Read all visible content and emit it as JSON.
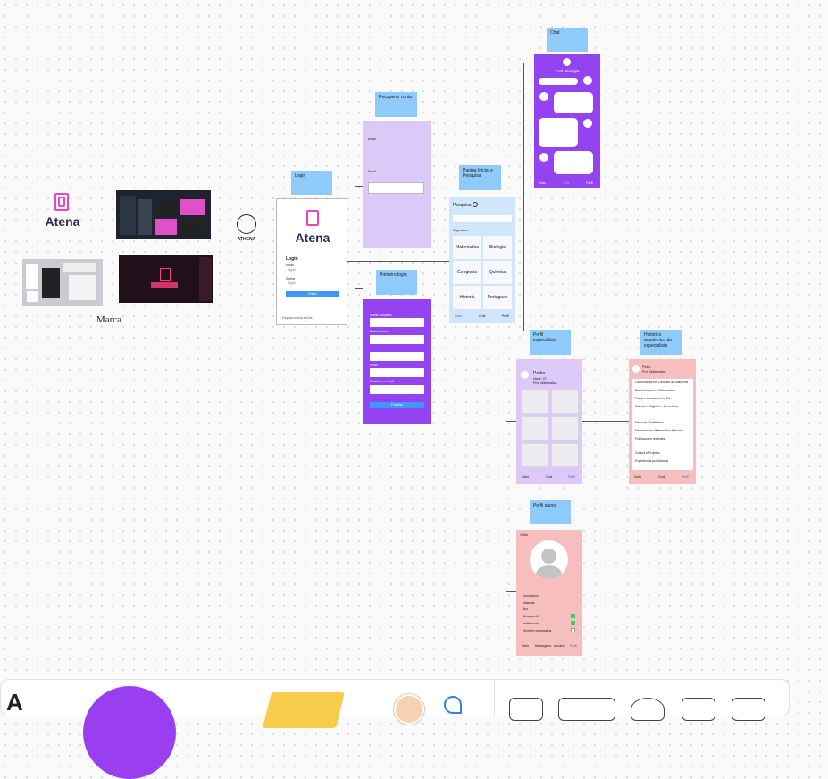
{
  "brand": {
    "name": "Atena",
    "caption": "Marca",
    "badge_name": "ATHENA"
  },
  "stickies": {
    "login": "Login",
    "recover": "Recuperar conta",
    "first_login": "Primeiro login",
    "home_search": "Pagina Inicial e Pesquisa",
    "chat": "Chat",
    "specialist_profile": "Perfil especialista",
    "specialist_history": "Historico academico do especialista",
    "student_profile": "Perfil aluno"
  },
  "login_screen": {
    "brand": "Atena",
    "title": "Login",
    "email_label": "Email",
    "email_placeholder": "Digite",
    "password_label": "Senha",
    "password_placeholder": "Digite",
    "button": "Entrar",
    "forgot": "Esqueci minha senha"
  },
  "recover_screen": {
    "label1": "Email",
    "label2": "Email"
  },
  "first_login_screen": {
    "field_labels": [
      "Nome completo",
      "Data de nasc.",
      "",
      "Email",
      "Confirme o email"
    ],
    "button": "Finalizar"
  },
  "search_screen": {
    "title": "Pesquisa",
    "suggestions_label": "Sugestoes",
    "subjects": [
      "Matematica",
      "Biologia",
      "Geografia",
      "Quimica",
      "Historia",
      "Portugues"
    ],
    "nav": [
      "Inicio",
      "Chat",
      "Perfil"
    ]
  },
  "chat_screen": {
    "title": "Prof. Biologia",
    "nav": [
      "Inicio",
      "Chat",
      "Perfil"
    ]
  },
  "specialist_profile_screen": {
    "name": "Pedro",
    "age": "Idade: 27",
    "role": "Prof. Matematica",
    "nav": [
      "Inicio",
      "Chat",
      "Perfil"
    ]
  },
  "history_screen": {
    "name": "Pedro",
    "role": "Prof. Matematica",
    "lines": [
      "Licenciatura em Ciencias da Natureza",
      "Bacharelado em Matematica",
      "Fisica e Inovacoes na Ed.",
      "Calculo I / Algebra / Geometria",
      "Metodos Estatisticos",
      "Mestrado em Matematica Aplicada",
      "Publicacoes recentes",
      "Cursos e Projetos",
      "Experiencia profissional"
    ],
    "nav": [
      "Inicio",
      "Chat",
      "Perfil"
    ]
  },
  "student_profile_screen": {
    "back": "Voltar",
    "fields": [
      "Nome aluno",
      "Materias",
      "Ano",
      "Ativar perfil",
      "Notificacoes",
      "Receber mensagens"
    ],
    "nav": [
      "Inicio",
      "Mensagens",
      "Ajustes",
      "Perfil"
    ]
  },
  "colors": {
    "sticky": "#8ecbfb",
    "lavender": "#ddc9f7",
    "purple": "#9443f0",
    "lightblue": "#cfe6fb",
    "salmon": "#f6bfbd",
    "pink": "#e844c6",
    "toolbar_purple": "#9a3ff0",
    "toolbar_yellow": "#f6cd4a"
  },
  "toolbar": {
    "icons": [
      "text-tool-icon",
      "shape-tool-icon",
      "sticky-note-icon",
      "sticker-icon",
      "stamp-icon",
      "frame-tool-icon",
      "table-tool-icon",
      "comment-tool-icon",
      "section-tool-icon",
      "more-tool-icon"
    ]
  }
}
